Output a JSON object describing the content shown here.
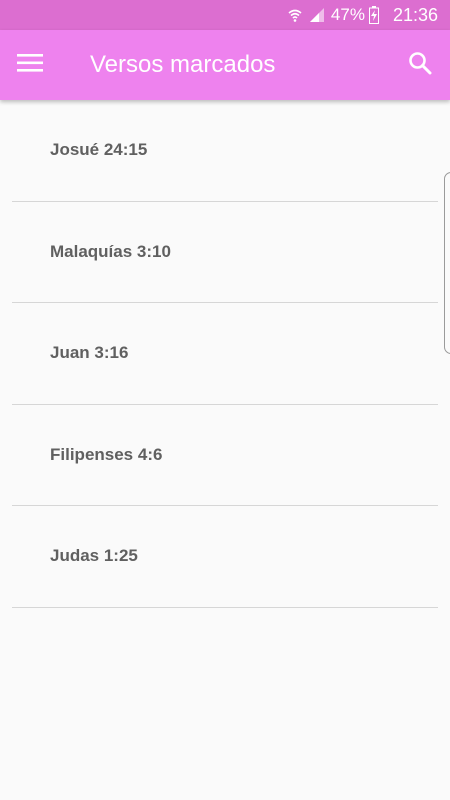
{
  "status_bar": {
    "battery_percent": "47%",
    "time": "21:36",
    "icons": [
      "wifi-icon",
      "signal-icon",
      "battery-charging-icon"
    ]
  },
  "app_bar": {
    "title": "Versos marcados",
    "menu_icon": "hamburger-menu-icon",
    "search_icon": "search-icon",
    "background": "#ee82ee"
  },
  "verses": [
    {
      "label": "Josué 24:15"
    },
    {
      "label": "Malaquías 3:10"
    },
    {
      "label": "Juan 3:16"
    },
    {
      "label": "Filipenses 4:6"
    },
    {
      "label": "Judas 1:25"
    }
  ]
}
